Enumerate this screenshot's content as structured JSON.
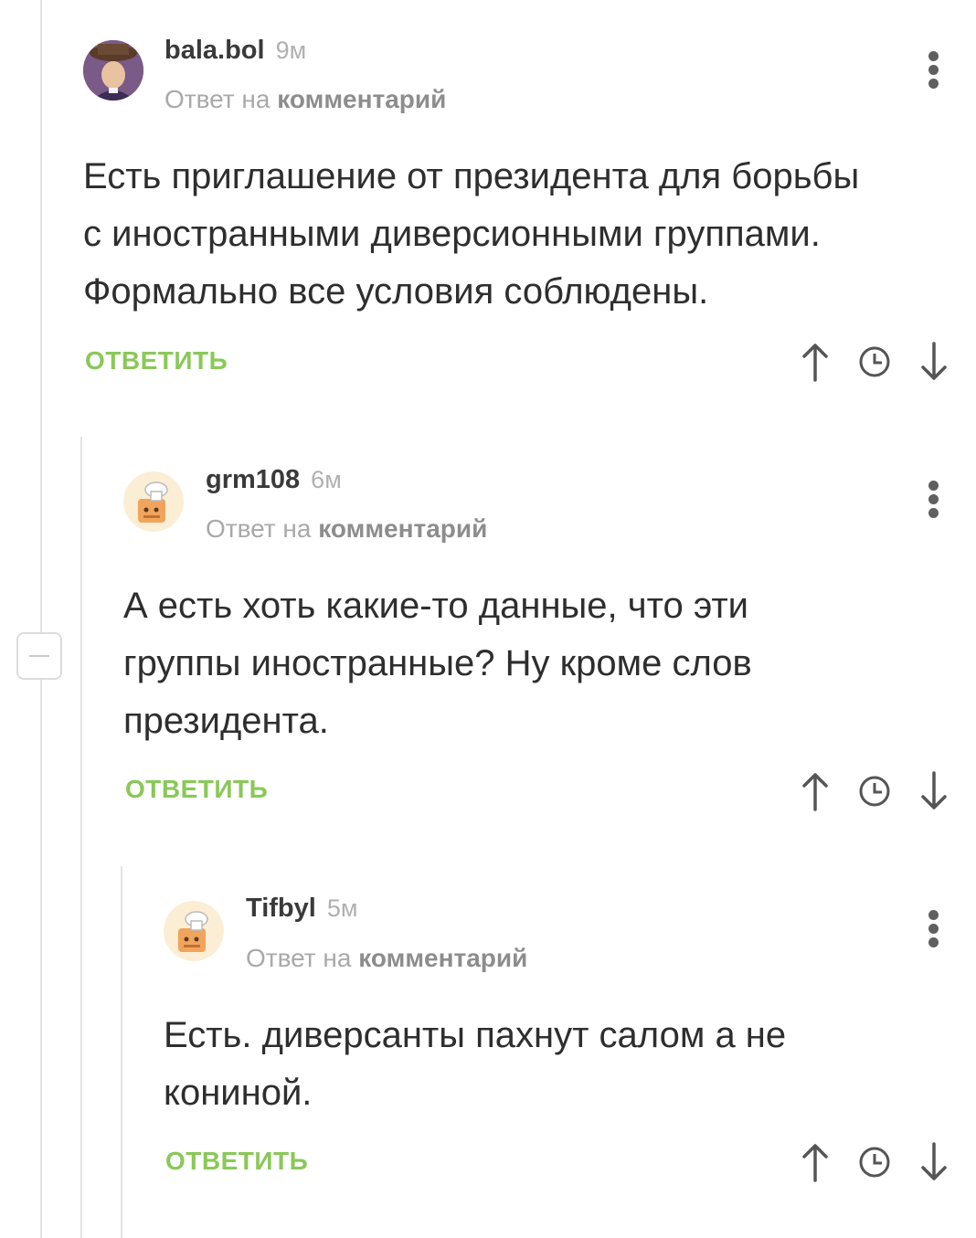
{
  "comments": [
    {
      "username": "bala.bol",
      "time": "9м",
      "reply_prefix": "Ответ на",
      "reply_link": "комментарий",
      "text_lines": [
        "Есть приглашение от президента для борьбы",
        "с иностранными диверсионными группами.",
        "Формально все условия соблюдены."
      ],
      "reply_label": "ОТВЕТИТЬ"
    },
    {
      "username": "grm108",
      "time": "6м",
      "reply_prefix": "Ответ на",
      "reply_link": "комментарий",
      "text_lines": [
        "А есть хоть какие-то данные, что эти",
        "группы иностранные? Ну кроме слов",
        "президента."
      ],
      "reply_label": "ОТВЕТИТЬ"
    },
    {
      "username": "Tifbyl",
      "time": "5м",
      "reply_prefix": "Ответ на",
      "reply_link": "комментарий",
      "text_lines": [
        "Есть. диверсанты пахнут салом а не",
        "кониной."
      ],
      "reply_label": "ОТВЕТИТЬ"
    }
  ],
  "colors": {
    "accent_green": "#8ac858",
    "muted_text": "#a9a9a9",
    "thread_line": "#e3e3e3"
  },
  "icons": [
    "kebab-menu-icon",
    "upvote-arrow-icon",
    "clock-icon",
    "downvote-arrow-icon",
    "collapse-thread-icon"
  ]
}
